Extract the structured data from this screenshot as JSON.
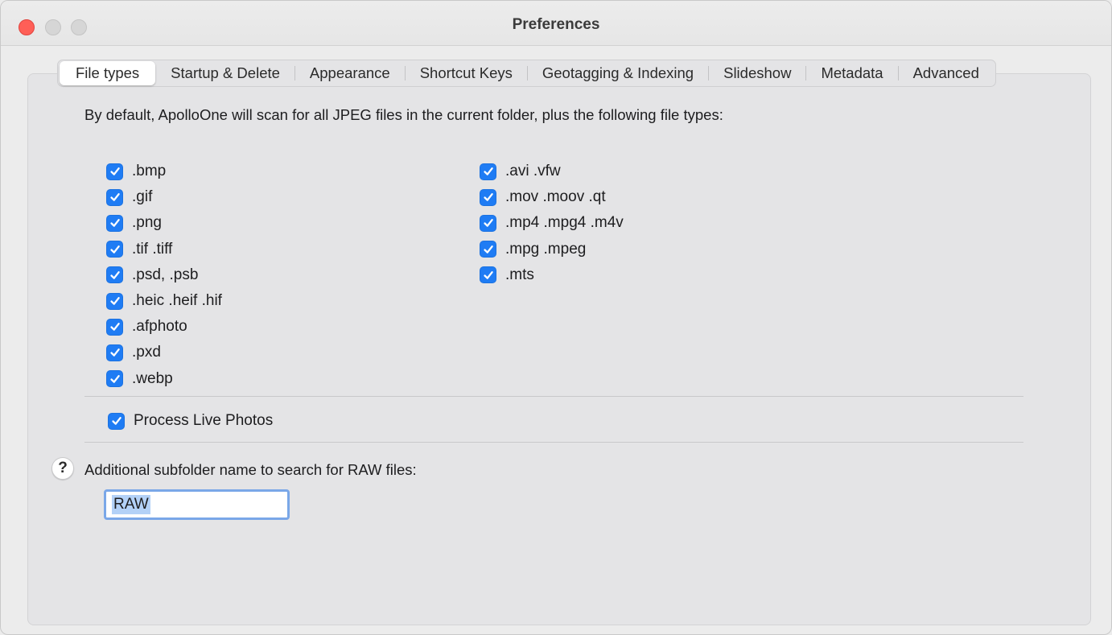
{
  "window": {
    "title": "Preferences"
  },
  "tabs": [
    {
      "label": "File types",
      "active": true
    },
    {
      "label": "Startup & Delete",
      "active": false
    },
    {
      "label": "Appearance",
      "active": false
    },
    {
      "label": "Shortcut Keys",
      "active": false
    },
    {
      "label": "Geotagging & Indexing",
      "active": false
    },
    {
      "label": "Slideshow",
      "active": false
    },
    {
      "label": "Metadata",
      "active": false
    },
    {
      "label": "Advanced",
      "active": false
    }
  ],
  "intro_text": "By default, ApolloOne will scan for all JPEG files in the current folder, plus the following file types:",
  "image_types": [
    {
      "label": ".bmp",
      "checked": true
    },
    {
      "label": ".gif",
      "checked": true
    },
    {
      "label": ".png",
      "checked": true
    },
    {
      "label": ".tif .tiff",
      "checked": true
    },
    {
      "label": ".psd, .psb",
      "checked": true
    },
    {
      "label": ".heic .heif .hif",
      "checked": true
    },
    {
      "label": ".afphoto",
      "checked": true
    },
    {
      "label": ".pxd",
      "checked": true
    },
    {
      "label": ".webp",
      "checked": true
    }
  ],
  "video_types": [
    {
      "label": ".avi .vfw",
      "checked": true
    },
    {
      "label": ".mov .moov .qt",
      "checked": true
    },
    {
      "label": ".mp4 .mpg4 .m4v",
      "checked": true
    },
    {
      "label": ".mpg .mpeg",
      "checked": true
    },
    {
      "label": ".mts",
      "checked": true
    }
  ],
  "live_photos": {
    "label": "Process Live Photos",
    "checked": true
  },
  "raw_subfolder": {
    "help_glyph": "?",
    "label": "Additional subfolder name to search for RAW files:",
    "value": "RAW"
  },
  "colors": {
    "accent": "#1f7cf4",
    "close_button": "#ff5f57",
    "focus_ring": "#7aa7e8",
    "selection": "#b3d1f7"
  }
}
